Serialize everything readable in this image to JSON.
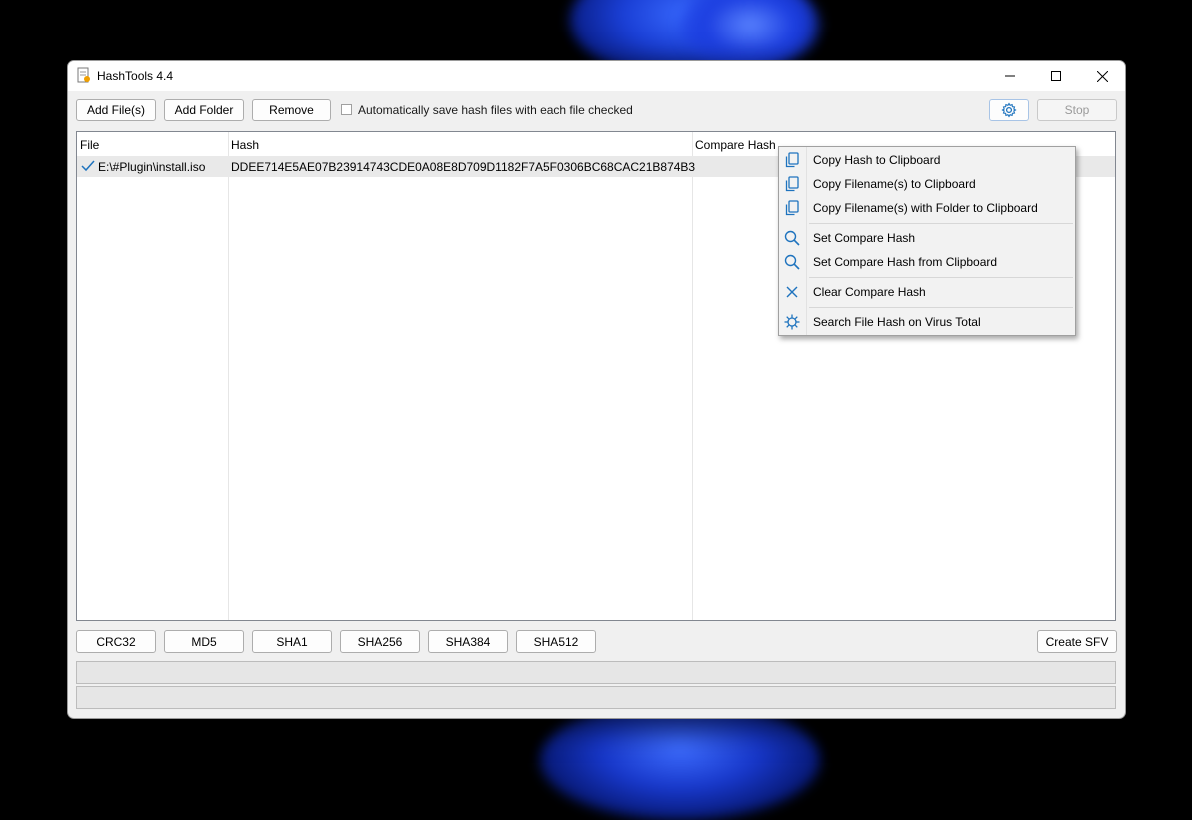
{
  "window": {
    "title": "HashTools 4.4"
  },
  "toolbar": {
    "add_files": "Add File(s)",
    "add_folder": "Add Folder",
    "remove": "Remove",
    "auto_save_label": "Automatically save hash files with each file checked",
    "auto_save_checked": false,
    "stop": "Stop",
    "settings_icon": "gear-icon"
  },
  "table": {
    "columns": [
      "File",
      "Hash",
      "Compare Hash"
    ],
    "rows": [
      {
        "file": "E:\\#Plugin\\install.iso",
        "hash": "DDEE714E5AE07B23914743CDE0A08E8D709D1182F7A5F0306BC68CAC21B874B3",
        "compare": ""
      }
    ]
  },
  "algorithms": [
    "CRC32",
    "MD5",
    "SHA1",
    "SHA256",
    "SHA384",
    "SHA512"
  ],
  "create_sfv": "Create SFV",
  "context_menu": {
    "items": [
      {
        "label": "Copy Hash to Clipboard",
        "icon": "copy-icon"
      },
      {
        "label": "Copy Filename(s) to Clipboard",
        "icon": "copy-icon"
      },
      {
        "label": "Copy Filename(s) with Folder to Clipboard",
        "icon": "copy-icon"
      },
      {
        "label": "Set Compare Hash",
        "icon": "search-icon"
      },
      {
        "label": "Set Compare Hash from Clipboard",
        "icon": "search-icon"
      },
      {
        "label": "Clear Compare Hash",
        "icon": "close-icon"
      },
      {
        "label": "Search File Hash on Virus Total",
        "icon": "virus-icon"
      }
    ]
  },
  "colors": {
    "accent": "#1e73be",
    "background": "#f0f0f0"
  }
}
